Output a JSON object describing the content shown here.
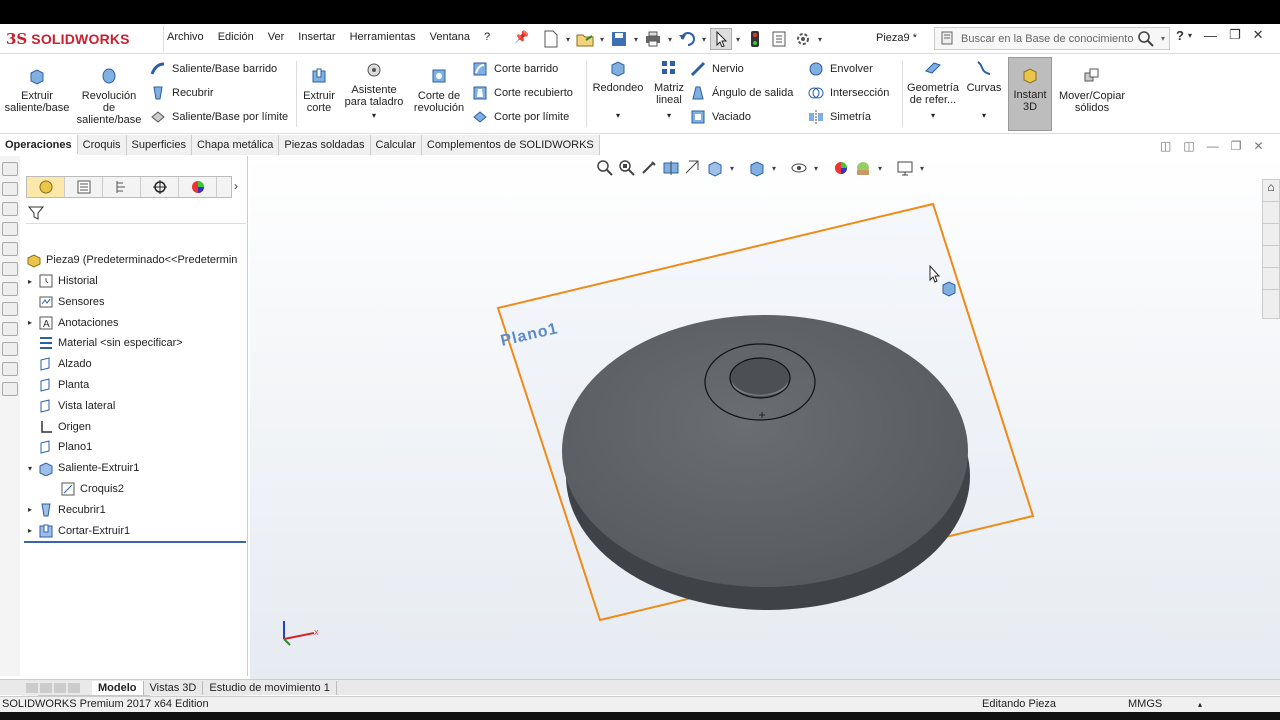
{
  "brand": {
    "logo_ds": "3S",
    "logo_text": "SOLIDWORKS"
  },
  "menu": [
    "Archivo",
    "Edición",
    "Ver",
    "Insertar",
    "Herramientas",
    "Ventana",
    "?"
  ],
  "document_title": "Pieza9 *",
  "search_placeholder": "Buscar en la Base de conocimiento",
  "help_label": "?",
  "features": {
    "extrude_boss": "Extruir saliente/base",
    "revolve_boss": "Revolución de saliente/base",
    "swept_boss": "Saliente/Base barrido",
    "loft_boss": "Recubrir",
    "boundary_boss": "Saliente/Base por límite",
    "extrude_cut": "Extruir corte",
    "hole_wizard": "Asistente para taladro",
    "revolve_cut": "Corte de revolución",
    "swept_cut": "Corte barrido",
    "lofted_cut": "Corte recubierto",
    "boundary_cut": "Corte por límite",
    "fillet": "Redondeo",
    "linear_pattern": "Matriz lineal",
    "rib": "Nervio",
    "draft": "Ángulo de salida",
    "shell": "Vaciado",
    "wrap": "Envolver",
    "intersect": "Intersección",
    "mirror": "Simetría",
    "ref_geometry": "Geometría de refer...",
    "curves": "Curvas",
    "instant3d": "Instant 3D",
    "move_copy": "Mover/Copiar sólidos"
  },
  "tabs": [
    "Operaciones",
    "Croquis",
    "Superficies",
    "Chapa metálica",
    "Piezas soldadas",
    "Calcular",
    "Complementos de SOLIDWORKS"
  ],
  "active_tab": "Operaciones",
  "tree": {
    "root": "Pieza9  (Predeterminado<<Predetermin",
    "items": [
      {
        "label": "Historial",
        "expandable": true,
        "icon": "history-icon"
      },
      {
        "label": "Sensores",
        "expandable": false,
        "icon": "sensor-icon"
      },
      {
        "label": "Anotaciones",
        "expandable": true,
        "icon": "annotation-icon"
      },
      {
        "label": "Material <sin especificar>",
        "expandable": false,
        "icon": "material-icon"
      },
      {
        "label": "Alzado",
        "expandable": false,
        "icon": "plane-icon"
      },
      {
        "label": "Planta",
        "expandable": false,
        "icon": "plane-icon"
      },
      {
        "label": "Vista lateral",
        "expandable": false,
        "icon": "plane-icon"
      },
      {
        "label": "Origen",
        "expandable": false,
        "icon": "origin-icon"
      },
      {
        "label": "Plano1",
        "expandable": false,
        "icon": "plane-icon"
      },
      {
        "label": "Saliente-Extruir1",
        "expandable": true,
        "icon": "extrude-icon"
      },
      {
        "label": "Croquis2",
        "expandable": false,
        "icon": "sketch-icon"
      },
      {
        "label": "Recubrir1",
        "expandable": true,
        "icon": "loft-icon"
      },
      {
        "label": "Cortar-Extruir1",
        "expandable": true,
        "icon": "cut-extrude-icon"
      }
    ]
  },
  "viewport": {
    "plane_label": "Plano1",
    "axis_x": "X"
  },
  "bottom_tabs": [
    "Modelo",
    "Vistas 3D",
    "Estudio de movimiento 1"
  ],
  "active_bottom_tab": "Modelo",
  "status": {
    "edition": "SOLIDWORKS Premium 2017 x64 Edition",
    "mode": "Editando Pieza",
    "units": "MMGS"
  },
  "colors": {
    "brand_red": "#c8202f",
    "plane_orange": "#ef8a17",
    "part_gray": "#5f6368",
    "instant3d_active": "#bdbdbd"
  }
}
